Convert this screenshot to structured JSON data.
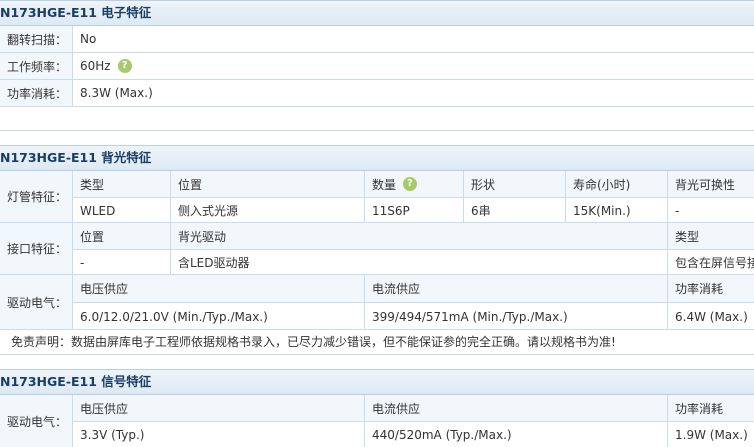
{
  "sections": {
    "electrical": {
      "title": "N173HGE-E11 电子特征",
      "flip_label": "翻转扫描：",
      "flip_value": "No",
      "freq_label": "工作频率：",
      "freq_value": "60Hz",
      "power_label": "功率消耗：",
      "power_value": "8.3W (Max.)"
    },
    "backlight": {
      "title": "N173HGE-E11 背光特征",
      "lamp_label": "灯管特征：",
      "lamp_headers": [
        "类型",
        "位置",
        "数量",
        "形状",
        "寿命(小时)",
        "背光可换性"
      ],
      "lamp_values": [
        "WLED",
        "侧入式光源",
        "11S6P",
        "6串",
        "15K(Min.)",
        "-"
      ],
      "iface_label": "接口特征：",
      "iface_headers": [
        "位置",
        "背光驱动",
        "类型"
      ],
      "iface_values": [
        "-",
        "含LED驱动器",
        "包含在屏信号接"
      ],
      "drive_label": "驱动电气：",
      "drive_headers": [
        "电压供应",
        "电流供应",
        "功率消耗"
      ],
      "drive_values": [
        "6.0/12.0/21.0V (Min./Typ./Max.)",
        "399/494/571mA (Min./Typ./Max.)",
        "6.4W (Max.)"
      ],
      "disclaimer": "免责声明：数据由屏库电子工程师依据规格书录入，已尽力减少错误，但不能保证参的完全正确。请以规格书为准!"
    },
    "signal": {
      "title": "N173HGE-E11 信号特征",
      "drive_label": "驱动电气：",
      "drive_headers": [
        "电压供应",
        "电流供应",
        "功率消耗"
      ],
      "drive_values": [
        "3.3V (Typ.)",
        "440/520mA (Typ./Max.)",
        "1.9W (Max.)"
      ]
    }
  },
  "help_icon": "question-icon"
}
